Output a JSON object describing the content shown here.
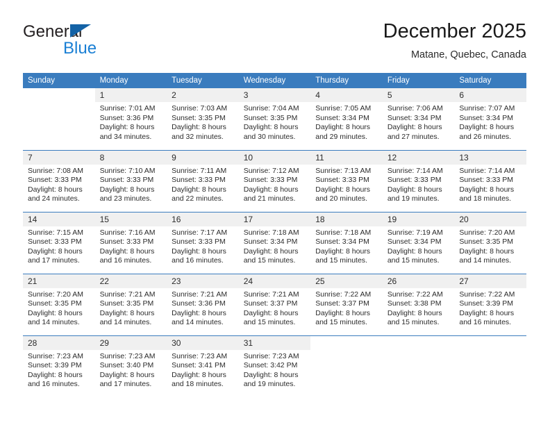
{
  "brand": {
    "name_part1": "General",
    "name_part2": "Blue",
    "triangle_icon": "triangle-icon",
    "accent_color": "#1a7fd4",
    "header_color": "#3a7cbe"
  },
  "header": {
    "title": "December 2025",
    "subtitle": "Matane, Quebec, Canada"
  },
  "weekday_headers": [
    "Sunday",
    "Monday",
    "Tuesday",
    "Wednesday",
    "Thursday",
    "Friday",
    "Saturday"
  ],
  "weeks": [
    [
      {
        "day": "",
        "blank": true
      },
      {
        "day": "1",
        "sunrise": "Sunrise: 7:01 AM",
        "sunset": "Sunset: 3:36 PM",
        "daylight_line1": "Daylight: 8 hours",
        "daylight_line2": "and 34 minutes."
      },
      {
        "day": "2",
        "sunrise": "Sunrise: 7:03 AM",
        "sunset": "Sunset: 3:35 PM",
        "daylight_line1": "Daylight: 8 hours",
        "daylight_line2": "and 32 minutes."
      },
      {
        "day": "3",
        "sunrise": "Sunrise: 7:04 AM",
        "sunset": "Sunset: 3:35 PM",
        "daylight_line1": "Daylight: 8 hours",
        "daylight_line2": "and 30 minutes."
      },
      {
        "day": "4",
        "sunrise": "Sunrise: 7:05 AM",
        "sunset": "Sunset: 3:34 PM",
        "daylight_line1": "Daylight: 8 hours",
        "daylight_line2": "and 29 minutes."
      },
      {
        "day": "5",
        "sunrise": "Sunrise: 7:06 AM",
        "sunset": "Sunset: 3:34 PM",
        "daylight_line1": "Daylight: 8 hours",
        "daylight_line2": "and 27 minutes."
      },
      {
        "day": "6",
        "sunrise": "Sunrise: 7:07 AM",
        "sunset": "Sunset: 3:34 PM",
        "daylight_line1": "Daylight: 8 hours",
        "daylight_line2": "and 26 minutes."
      }
    ],
    [
      {
        "day": "7",
        "sunrise": "Sunrise: 7:08 AM",
        "sunset": "Sunset: 3:33 PM",
        "daylight_line1": "Daylight: 8 hours",
        "daylight_line2": "and 24 minutes."
      },
      {
        "day": "8",
        "sunrise": "Sunrise: 7:10 AM",
        "sunset": "Sunset: 3:33 PM",
        "daylight_line1": "Daylight: 8 hours",
        "daylight_line2": "and 23 minutes."
      },
      {
        "day": "9",
        "sunrise": "Sunrise: 7:11 AM",
        "sunset": "Sunset: 3:33 PM",
        "daylight_line1": "Daylight: 8 hours",
        "daylight_line2": "and 22 minutes."
      },
      {
        "day": "10",
        "sunrise": "Sunrise: 7:12 AM",
        "sunset": "Sunset: 3:33 PM",
        "daylight_line1": "Daylight: 8 hours",
        "daylight_line2": "and 21 minutes."
      },
      {
        "day": "11",
        "sunrise": "Sunrise: 7:13 AM",
        "sunset": "Sunset: 3:33 PM",
        "daylight_line1": "Daylight: 8 hours",
        "daylight_line2": "and 20 minutes."
      },
      {
        "day": "12",
        "sunrise": "Sunrise: 7:14 AM",
        "sunset": "Sunset: 3:33 PM",
        "daylight_line1": "Daylight: 8 hours",
        "daylight_line2": "and 19 minutes."
      },
      {
        "day": "13",
        "sunrise": "Sunrise: 7:14 AM",
        "sunset": "Sunset: 3:33 PM",
        "daylight_line1": "Daylight: 8 hours",
        "daylight_line2": "and 18 minutes."
      }
    ],
    [
      {
        "day": "14",
        "sunrise": "Sunrise: 7:15 AM",
        "sunset": "Sunset: 3:33 PM",
        "daylight_line1": "Daylight: 8 hours",
        "daylight_line2": "and 17 minutes."
      },
      {
        "day": "15",
        "sunrise": "Sunrise: 7:16 AM",
        "sunset": "Sunset: 3:33 PM",
        "daylight_line1": "Daylight: 8 hours",
        "daylight_line2": "and 16 minutes."
      },
      {
        "day": "16",
        "sunrise": "Sunrise: 7:17 AM",
        "sunset": "Sunset: 3:33 PM",
        "daylight_line1": "Daylight: 8 hours",
        "daylight_line2": "and 16 minutes."
      },
      {
        "day": "17",
        "sunrise": "Sunrise: 7:18 AM",
        "sunset": "Sunset: 3:34 PM",
        "daylight_line1": "Daylight: 8 hours",
        "daylight_line2": "and 15 minutes."
      },
      {
        "day": "18",
        "sunrise": "Sunrise: 7:18 AM",
        "sunset": "Sunset: 3:34 PM",
        "daylight_line1": "Daylight: 8 hours",
        "daylight_line2": "and 15 minutes."
      },
      {
        "day": "19",
        "sunrise": "Sunrise: 7:19 AM",
        "sunset": "Sunset: 3:34 PM",
        "daylight_line1": "Daylight: 8 hours",
        "daylight_line2": "and 15 minutes."
      },
      {
        "day": "20",
        "sunrise": "Sunrise: 7:20 AM",
        "sunset": "Sunset: 3:35 PM",
        "daylight_line1": "Daylight: 8 hours",
        "daylight_line2": "and 14 minutes."
      }
    ],
    [
      {
        "day": "21",
        "sunrise": "Sunrise: 7:20 AM",
        "sunset": "Sunset: 3:35 PM",
        "daylight_line1": "Daylight: 8 hours",
        "daylight_line2": "and 14 minutes."
      },
      {
        "day": "22",
        "sunrise": "Sunrise: 7:21 AM",
        "sunset": "Sunset: 3:35 PM",
        "daylight_line1": "Daylight: 8 hours",
        "daylight_line2": "and 14 minutes."
      },
      {
        "day": "23",
        "sunrise": "Sunrise: 7:21 AM",
        "sunset": "Sunset: 3:36 PM",
        "daylight_line1": "Daylight: 8 hours",
        "daylight_line2": "and 14 minutes."
      },
      {
        "day": "24",
        "sunrise": "Sunrise: 7:21 AM",
        "sunset": "Sunset: 3:37 PM",
        "daylight_line1": "Daylight: 8 hours",
        "daylight_line2": "and 15 minutes."
      },
      {
        "day": "25",
        "sunrise": "Sunrise: 7:22 AM",
        "sunset": "Sunset: 3:37 PM",
        "daylight_line1": "Daylight: 8 hours",
        "daylight_line2": "and 15 minutes."
      },
      {
        "day": "26",
        "sunrise": "Sunrise: 7:22 AM",
        "sunset": "Sunset: 3:38 PM",
        "daylight_line1": "Daylight: 8 hours",
        "daylight_line2": "and 15 minutes."
      },
      {
        "day": "27",
        "sunrise": "Sunrise: 7:22 AM",
        "sunset": "Sunset: 3:39 PM",
        "daylight_line1": "Daylight: 8 hours",
        "daylight_line2": "and 16 minutes."
      }
    ],
    [
      {
        "day": "28",
        "sunrise": "Sunrise: 7:23 AM",
        "sunset": "Sunset: 3:39 PM",
        "daylight_line1": "Daylight: 8 hours",
        "daylight_line2": "and 16 minutes."
      },
      {
        "day": "29",
        "sunrise": "Sunrise: 7:23 AM",
        "sunset": "Sunset: 3:40 PM",
        "daylight_line1": "Daylight: 8 hours",
        "daylight_line2": "and 17 minutes."
      },
      {
        "day": "30",
        "sunrise": "Sunrise: 7:23 AM",
        "sunset": "Sunset: 3:41 PM",
        "daylight_line1": "Daylight: 8 hours",
        "daylight_line2": "and 18 minutes."
      },
      {
        "day": "31",
        "sunrise": "Sunrise: 7:23 AM",
        "sunset": "Sunset: 3:42 PM",
        "daylight_line1": "Daylight: 8 hours",
        "daylight_line2": "and 19 minutes."
      },
      {
        "day": "",
        "blank": true
      },
      {
        "day": "",
        "blank": true
      },
      {
        "day": "",
        "blank": true
      }
    ]
  ]
}
